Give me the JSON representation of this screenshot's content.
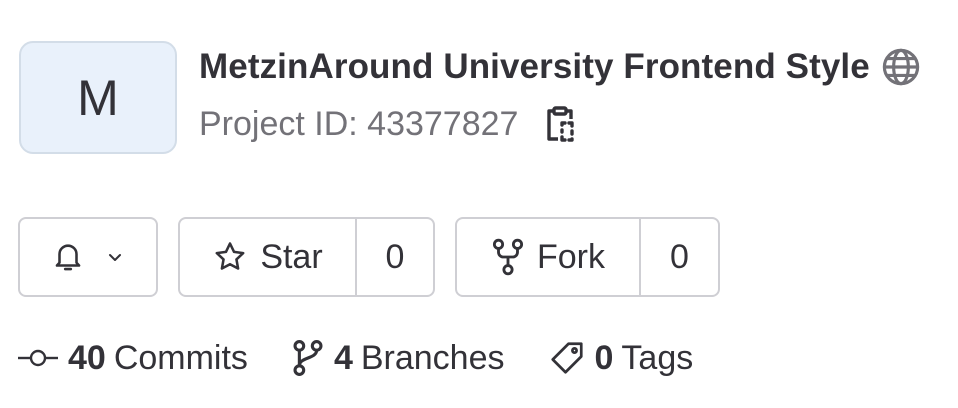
{
  "project": {
    "avatar_letter": "M",
    "title": "MetzinAround University Frontend Style",
    "visibility_icon": "globe-icon",
    "id_text": "Project ID: 43377827"
  },
  "actions": {
    "notifications_icon": "bell-icon",
    "star_label": "Star",
    "star_count": "0",
    "fork_label": "Fork",
    "fork_count": "0"
  },
  "stats": {
    "commits_count": "40",
    "commits_label": "Commits",
    "branches_count": "4",
    "branches_label": "Branches",
    "tags_count": "0",
    "tags_label": "Tags"
  }
}
